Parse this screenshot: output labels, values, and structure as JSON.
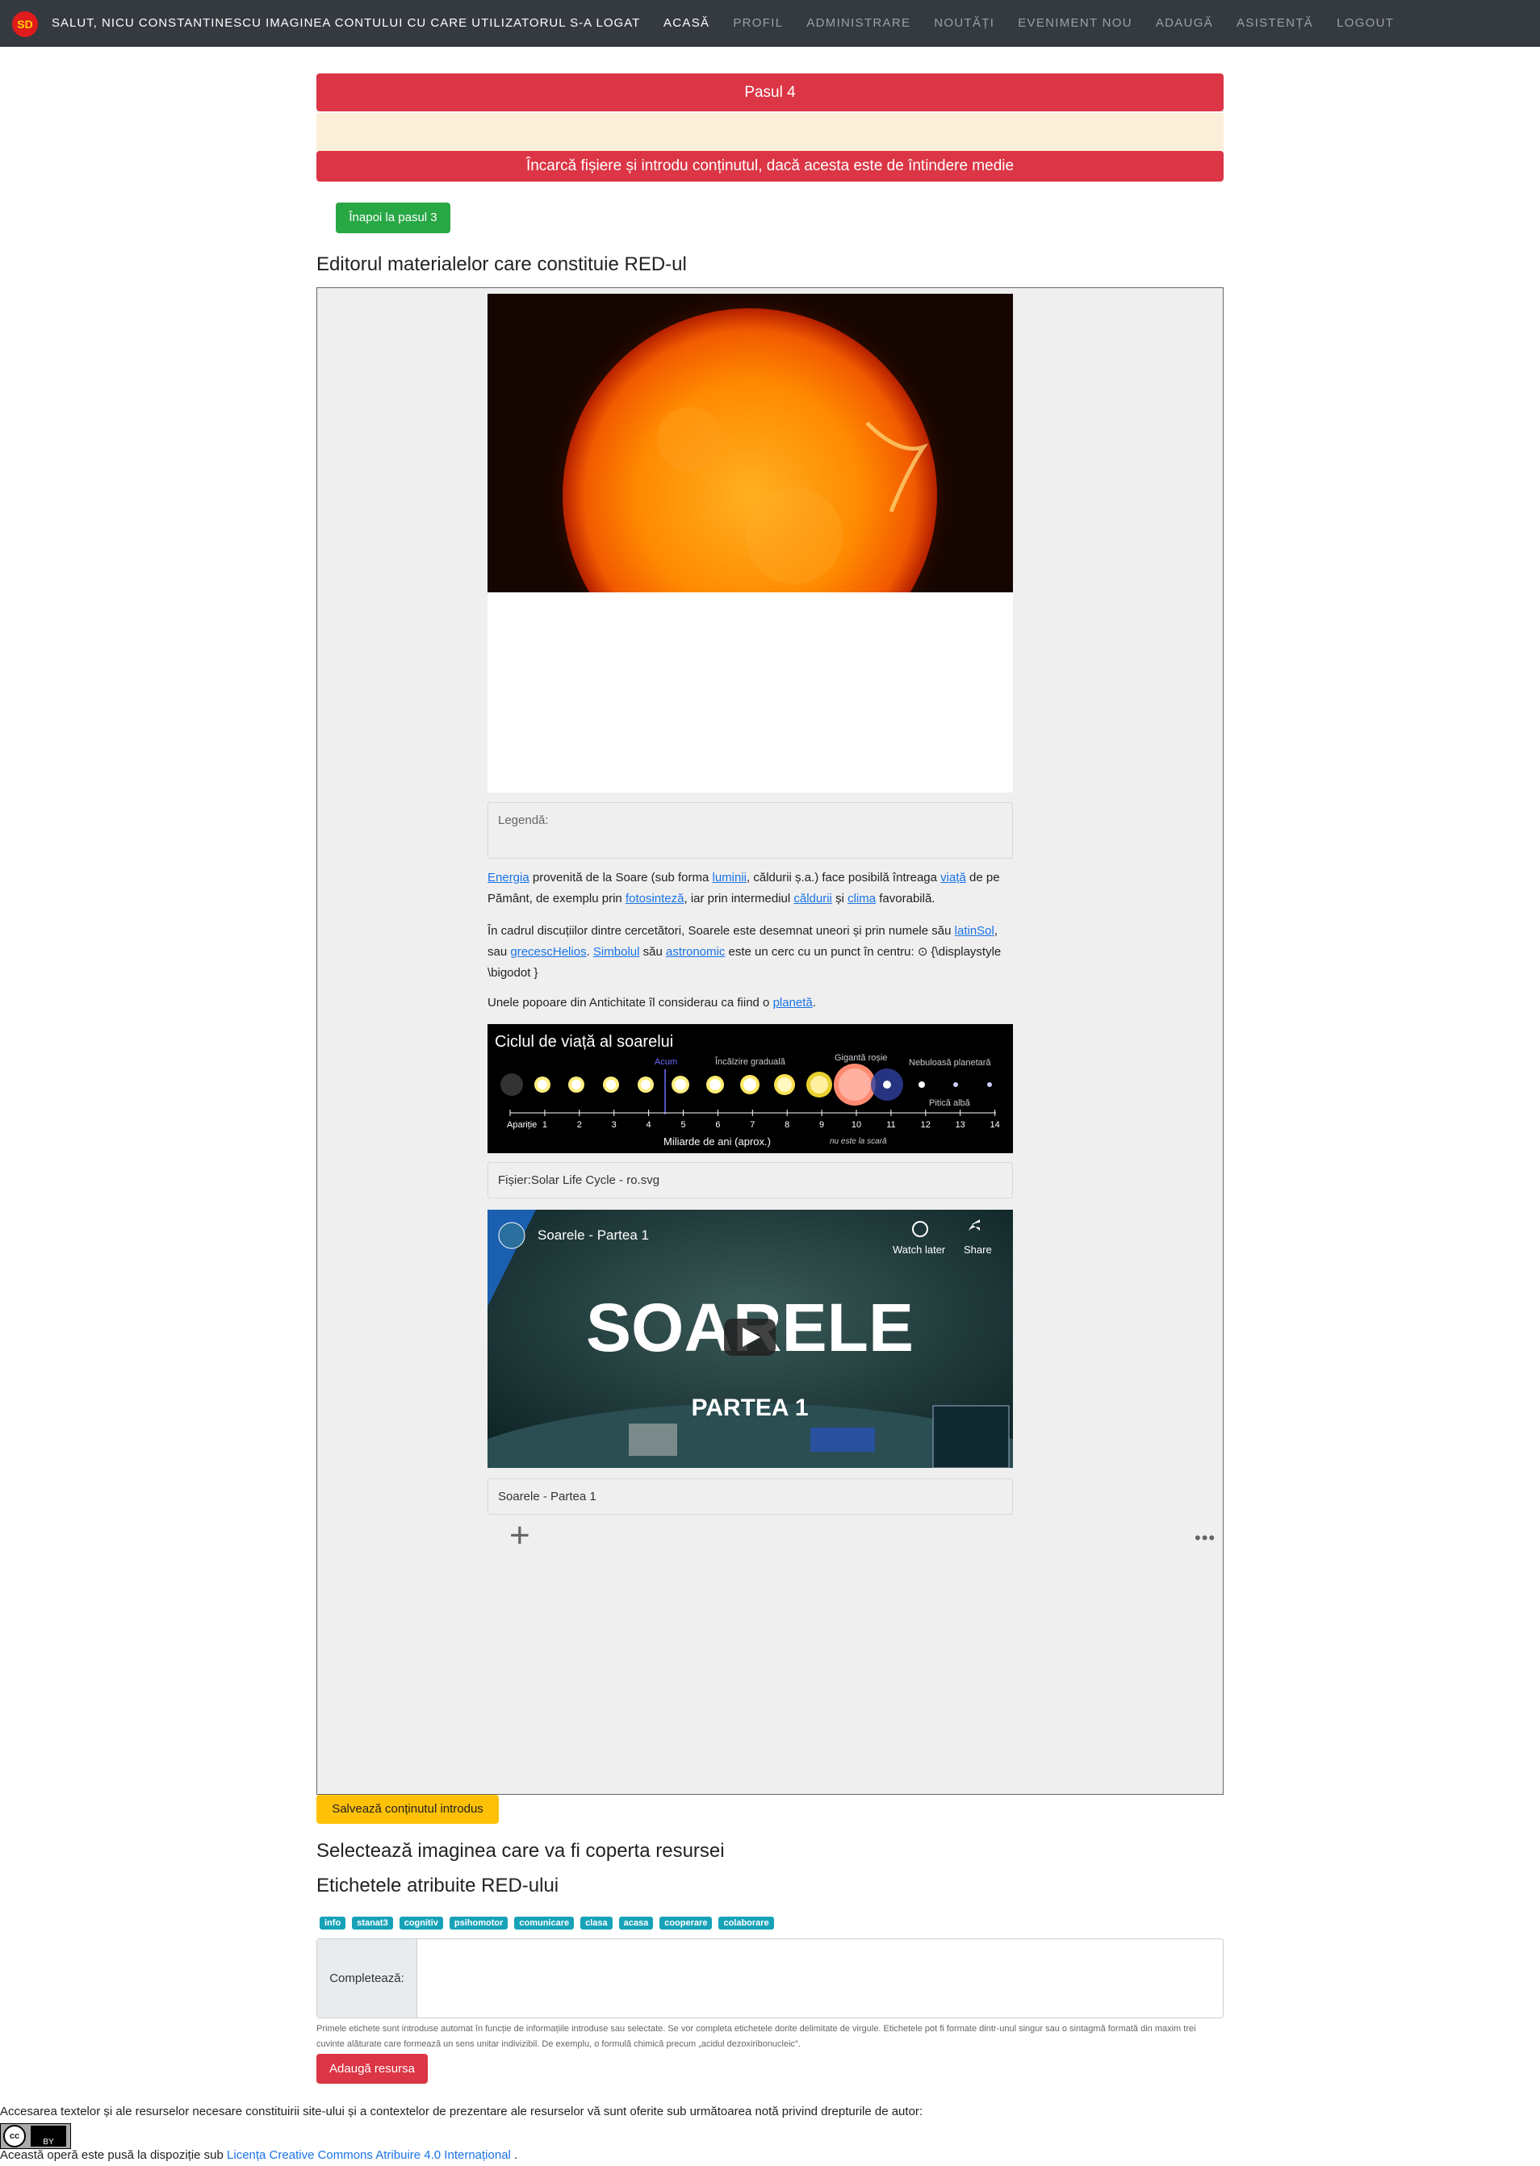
{
  "nav": {
    "logo": "SD",
    "greeting": "Salut, Nicu Constantinescu imaginea contului cu care utilizatorul s-a logat",
    "links": [
      "ACASĂ",
      "PROFIL",
      "ADMINISTRARE",
      "NOUTĂȚI",
      "EVENIMENT NOU",
      "ADAUGĂ",
      "ASISTENȚĂ",
      "LOGOUT"
    ]
  },
  "step_label": "Pasul 4",
  "instruction": "Încarcă fișiere și introdu conținutul, dacă acesta este de întindere medie",
  "back_button": "Înapoi la pasul 3",
  "editor_title": "Editorul materialelor care constituie RED-ul",
  "editor": {
    "caption_label": "Legendă:",
    "para1": {
      "w1": "Energia",
      "t1": " provenită de la Soare (sub forma ",
      "w2": "luminii",
      "t2": ", căldurii ș.a.) face posibilă întreaga ",
      "w3": "viață",
      "t3": " de pe Pământ, de exemplu prin ",
      "w4": "fotosinteză",
      "t4": ", iar prin intermediul ",
      "w5": "căldurii",
      "t5": " și ",
      "w6": "clima",
      "t6": " favorabilă."
    },
    "para2": {
      "t1": "În cadrul discuțiilor dintre cercetători, Soarele este desemnat uneori și prin numele său ",
      "w1": "latinSol",
      "t2": ", sau ",
      "w2": "grecescHelios",
      "t3": ". ",
      "w3": "Simbolul",
      "t4": " său ",
      "w4": "astronomic",
      "t5": " este un cerc cu un punct în centru: ⊙ {\\displaystyle \\bigodot }"
    },
    "para3": {
      "t1": "Unele popoare din Antichitate îl considerau ca fiind o ",
      "w1": "planetă",
      "t2": "."
    },
    "cycle": {
      "title": "Ciclul de viață al soarelui",
      "now": "Acum",
      "warming": "Încălzire graduală",
      "giant": "Gigantă roșie",
      "nebula": "Nebuloasă planetară",
      "dwarf": "Pitică albă",
      "ticks": [
        "Apariție",
        "1",
        "2",
        "3",
        "4",
        "5",
        "6",
        "7",
        "8",
        "9",
        "10",
        "11",
        "12",
        "13",
        "14"
      ],
      "axis_label": "Miliarde de ani (aprox.)",
      "scale_note": "nu este la scară"
    },
    "file_caption": "Fișier:Solar Life Cycle - ro.svg",
    "video": {
      "title": "Soarele - Partea 1",
      "watch_later": "Watch later",
      "share": "Share",
      "big_title": "SOARELE",
      "part": "PARTEA 1"
    },
    "video_caption": "Soarele - Partea 1",
    "plus": "+",
    "dots": "•••"
  },
  "save_button": "Salvează conținutul introdus",
  "cover_title": "Selectează imaginea care va fi coperta resursei",
  "tags_title": "Etichetele atribuite RED-ului",
  "tags": [
    "info",
    "stanat3",
    "cognitiv",
    "psihomotor",
    "comunicare",
    "clasa",
    "acasa",
    "cooperare",
    "colaborare"
  ],
  "complete_label": "Completează:",
  "hint": "Primele etichete sunt introduse automat în funcție de informațiile introduse sau selectate. Se vor completa etichetele dorite delimitate de virgule. Etichetele pot fi formate dintr-unul singur sau o sintagmă formată din maxim trei cuvinte alăturate care formează un sens unitar indivizibil. De exemplu, o formulă chimică precum „acidul dezoxiribonucleic”.",
  "add_button": "Adaugă resursa",
  "footer": {
    "notice": "Accesarea textelor și ale resurselor necesare constituirii site-ului și a contextelor de prezentare ale resurselor vă sunt oferite sub următoarea notă privind drepturile de autor:",
    "cc_text": "cc",
    "by_text": "BY",
    "license_prefix": "Această operă este pusă la dispoziție sub ",
    "license_link": "Licența Creative Commons Atribuire 4.0 Internațional",
    "license_suffix": " ."
  }
}
